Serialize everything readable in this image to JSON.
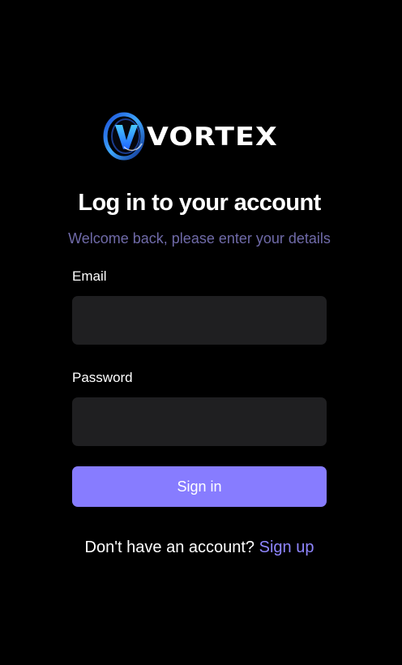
{
  "brand": {
    "name": "VORTEX",
    "mark_letter": "V"
  },
  "login": {
    "title": "Log in to your account",
    "subtitle": "Welcome back, please enter your details",
    "email_label": "Email",
    "email_value": "",
    "password_label": "Password",
    "password_value": "",
    "submit_label": "Sign in",
    "no_account_text": "Don't have an account?",
    "signup_link": "Sign up"
  },
  "colors": {
    "background": "#000000",
    "input_background": "#1f1f21",
    "accent": "#877cff",
    "link": "#8f86ff",
    "subtitle": "#6f6aa8"
  }
}
